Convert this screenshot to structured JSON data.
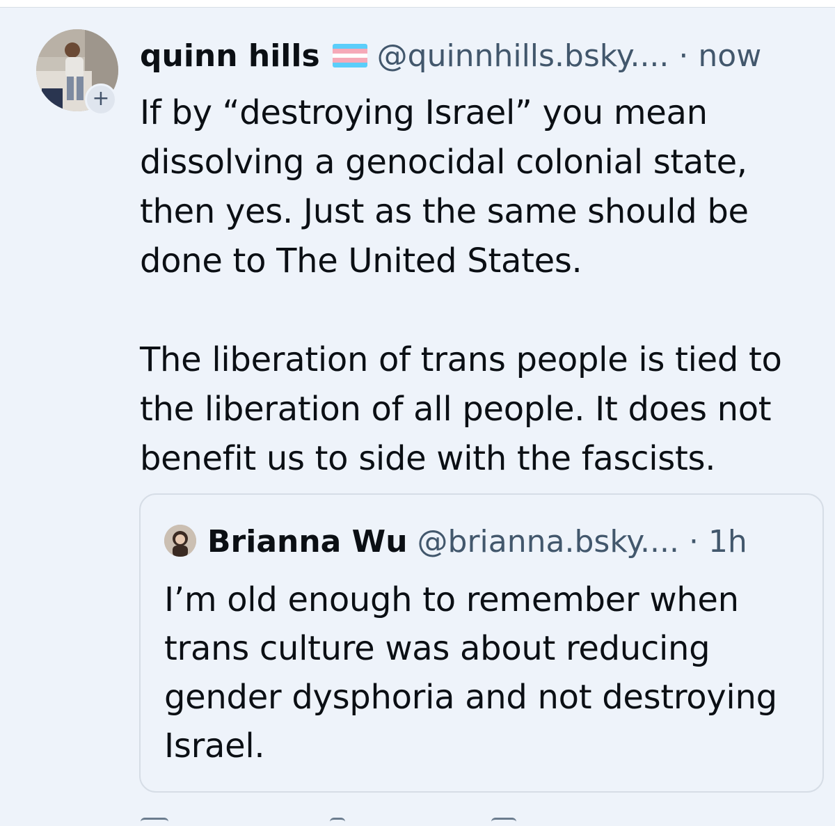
{
  "post": {
    "author_name": "quinn hills",
    "handle": "@quinnhills.bsky....",
    "separator": "·",
    "time": "now",
    "follow_symbol": "+",
    "paragraphs": [
      "If by “destroying Israel” you mean dissolving a genocidal colonial state, then yes. Just as the same should be done to The United States.",
      "The liberation of trans people is tied to the liberation of all people. It does not benefit us to side with the fascists."
    ]
  },
  "quote": {
    "author_name": "Brianna Wu",
    "handle": "@brianna.bsky....",
    "separator": "·",
    "time": "1h",
    "text": "I’m old enough to remember when trans culture was about reducing gender dysphoria and not destroying Israel."
  },
  "colors": {
    "background": "#eef3fa",
    "text_primary": "#0b0f14",
    "text_secondary": "#42576c",
    "border": "#d6dde6",
    "flag_blue": "#5bcefa",
    "flag_pink": "#f5a9b8",
    "flag_white": "#ffffff"
  },
  "icons": {
    "avatar": "user-avatar-photo",
    "follow": "plus-icon",
    "flag": "transgender-flag-icon",
    "quote_avatar": "quoted-user-avatar-photo",
    "actions": [
      "reply-icon",
      "repost-icon",
      "like-icon"
    ]
  }
}
